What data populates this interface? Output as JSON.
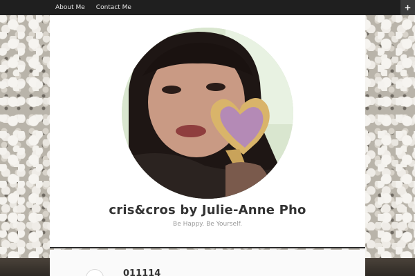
{
  "nav": {
    "items": [
      {
        "label": "About Me"
      },
      {
        "label": "Contact Me"
      }
    ],
    "plus_glyph": "+"
  },
  "header": {
    "site_title": "cris&cros by Julie-Anne Pho",
    "tagline": "Be Happy. Be Yourself.",
    "avatar_icon": "profile-photo"
  },
  "post": {
    "title": "011114"
  },
  "colors": {
    "topbar": "#1f1f1f",
    "panel": "#ffffff",
    "title": "#333333",
    "tagline": "#9a9a9a"
  }
}
